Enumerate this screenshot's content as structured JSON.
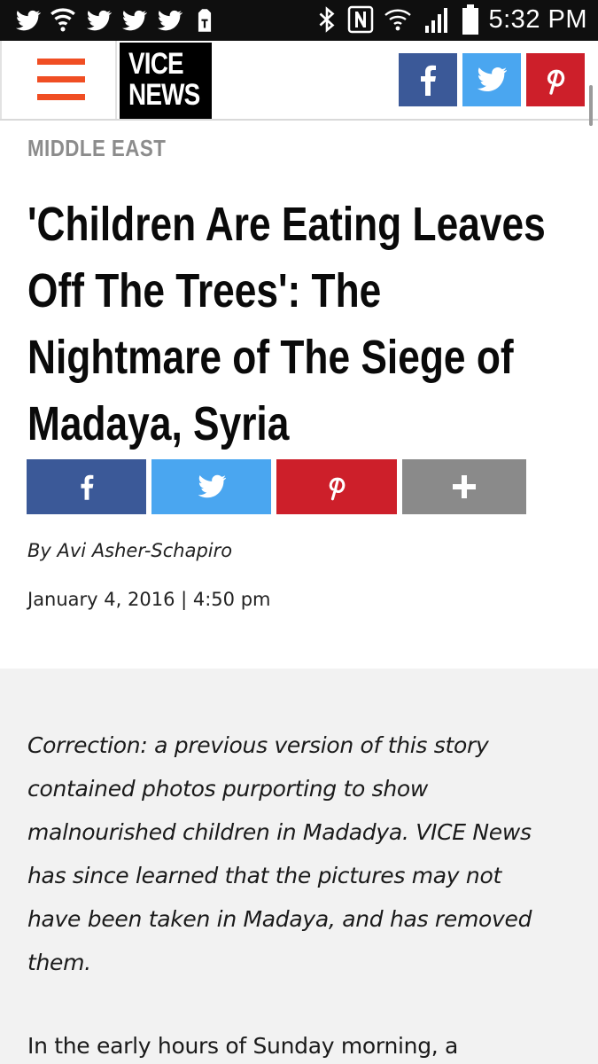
{
  "status_bar": {
    "time": "5:32 PM",
    "left_icons": [
      "twitter-icon",
      "wifi-calling-icon",
      "twitter-icon",
      "twitter-icon",
      "twitter-icon",
      "tmobile-icon"
    ],
    "right_icons": [
      "bluetooth-icon",
      "nfc-icon",
      "wifi-icon",
      "signal-icon",
      "battery-icon"
    ]
  },
  "header": {
    "logo_line1": "VICE",
    "logo_line2": "NEWS",
    "share_buttons": [
      {
        "name": "facebook",
        "color": "#3b5998"
      },
      {
        "name": "twitter",
        "color": "#4aa6f0"
      },
      {
        "name": "pinterest",
        "color": "#cd1f2a"
      }
    ],
    "menu_color": "#f04e23"
  },
  "article": {
    "section": "MIDDLE EAST",
    "title_lines": [
      "'Children Are Eating Leaves",
      "Off The Trees': The",
      "Nightmare of The Siege of",
      "Madaya, Syria"
    ],
    "share_buttons": [
      {
        "name": "facebook",
        "color": "#3b5998"
      },
      {
        "name": "twitter",
        "color": "#4aa6f0"
      },
      {
        "name": "pinterest",
        "color": "#cd1f2a"
      },
      {
        "name": "more",
        "color": "#8a8a8a"
      }
    ],
    "byline": "By Avi Asher-Schapiro",
    "date": "January 4, 2016 | 4:50 pm",
    "correction_lines": [
      "Correction: a previous version of this story",
      "contained photos purporting to show",
      "malnourished children in Madadya. VICE News",
      "has since learned that the pictures may not",
      "have been taken in Madaya, and has removed",
      "them."
    ],
    "body_start": "In the early hours of Sunday morning, a"
  }
}
